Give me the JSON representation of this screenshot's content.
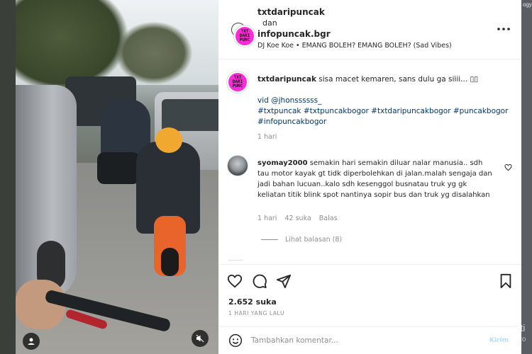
{
  "post": {
    "header": {
      "author1": "txtdaripuncak",
      "joiner": "dan",
      "author2": "infopuncak.bgr",
      "audio": "DJ Koe Koe • EMANG BOLEH? EMANG BOLEH? (Sad Vibes)",
      "avatar_text": "TXT DARI PUNC"
    },
    "caption": {
      "username": "txtdaripuncak",
      "text": "sisa macet kemaren, sans dulu ga siiii... ▯▯",
      "credit": "vid @jhonssssss_",
      "hashtags_line1": "#txtpuncak #txtpuncakbogor #txtdaripuncakbogor #puncakbogor",
      "hashtags_line2": "#infopuncakbogor",
      "time": "1 hari"
    },
    "comment": {
      "username": "syomay2000",
      "text": "semakin hari semakin diluar nalar manusia.. sdh tau motor kayak gt tidk diperbolehkan di jalan.malah sengaja dan jadi bahan lucuan..kalo sdh kesenggol busnatau truk yg gk keliatan titik blink spot nantinya sopir bus dan truk yg disalahkan",
      "time": "1 hari",
      "likes": "42 suka",
      "reply": "Balas",
      "view_replies": "Lihat balasan (8)"
    },
    "actions": {
      "likes_count": "2.652",
      "likes_label": "suka",
      "date": "1 HARI YANG LALU"
    },
    "add_comment": {
      "placeholder": "Tambahkan komentar...",
      "post_label": "Kirim"
    }
  },
  "overlay": {
    "watermark_line1": "Acti",
    "watermark_line2": "Go to",
    "corner_text": "ogy"
  },
  "colors": {
    "avatar_bg": "#ff2bd8",
    "link": "#00376b",
    "muted": "#8e8e8e",
    "post_button": "#b2dffc"
  }
}
